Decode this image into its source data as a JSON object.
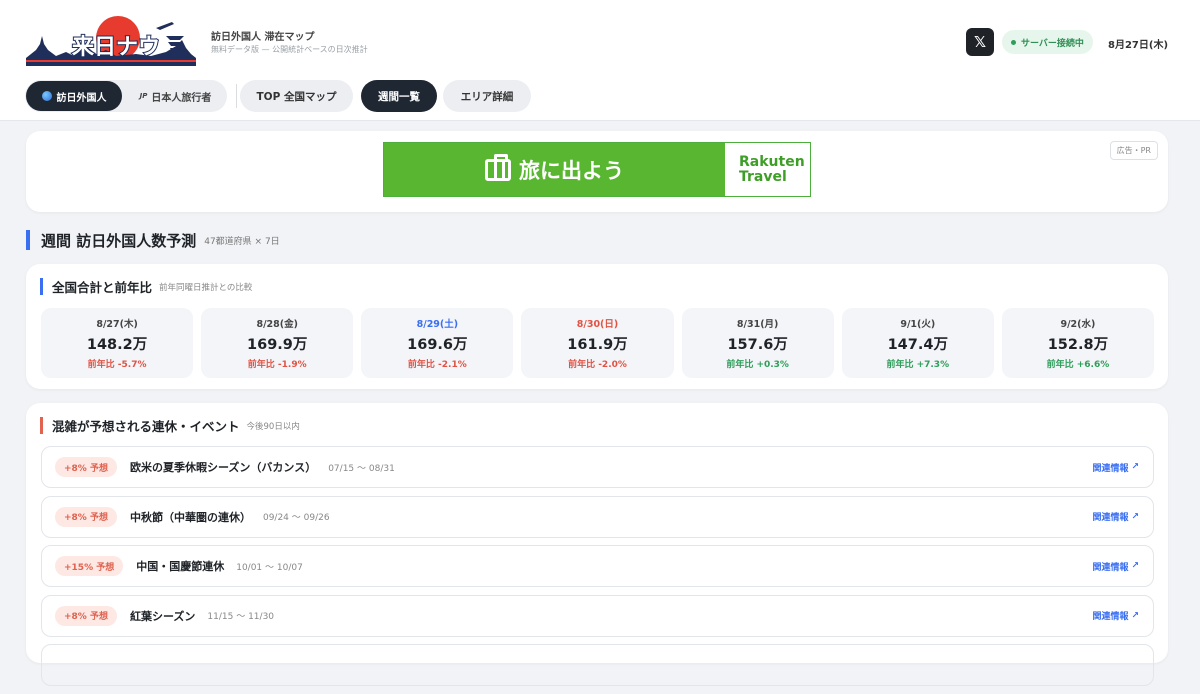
{
  "header": {
    "logo_text": "来日ナウ",
    "site_name": "訪日外国人 滞在マップ",
    "site_subtitle": "無料データ版 — 公開統計ベースの日次推計",
    "x_icon": "x-logo-icon",
    "status": "サーバー接続中",
    "status_color": "#2f9e5a",
    "date": "8月27日(木)"
  },
  "nav": {
    "segment": [
      {
        "label": "訪日外国人",
        "prefix": ""
      },
      {
        "label": "日本人旅行者",
        "prefix": "JP"
      }
    ],
    "pills": [
      {
        "label": "TOP 全国マップ"
      },
      {
        "label": "週間一覧"
      },
      {
        "label": "エリア詳細"
      }
    ],
    "active_pill": "週間一覧"
  },
  "ad": {
    "banner_text": "旅に出よう",
    "brand_line1": "Rakuten",
    "brand_line2": "Travel",
    "tag": "広告・PR",
    "brand_color": "#59b631"
  },
  "weekly": {
    "title": "週間 訪日外国人数予測",
    "subtitle": "47都道府県 × 7日"
  },
  "totals": {
    "title": "全国合計と前年比",
    "subtitle": "前年同曜日推計との比較",
    "days": [
      {
        "label": "8/27(木)",
        "value": "148.2万",
        "yoy": "前年比 -5.7%",
        "kind": "",
        "trend": "neg"
      },
      {
        "label": "8/28(金)",
        "value": "169.9万",
        "yoy": "前年比 -1.9%",
        "kind": "",
        "trend": "neg"
      },
      {
        "label": "8/29(土)",
        "value": "169.6万",
        "yoy": "前年比 -2.1%",
        "kind": "sat",
        "trend": "neg"
      },
      {
        "label": "8/30(日)",
        "value": "161.9万",
        "yoy": "前年比 -2.0%",
        "kind": "sun",
        "trend": "neg"
      },
      {
        "label": "8/31(月)",
        "value": "157.6万",
        "yoy": "前年比 +0.3%",
        "kind": "",
        "trend": "pos"
      },
      {
        "label": "9/1(火)",
        "value": "147.4万",
        "yoy": "前年比 +7.3%",
        "kind": "",
        "trend": "pos"
      },
      {
        "label": "9/2(水)",
        "value": "152.8万",
        "yoy": "前年比 +6.6%",
        "kind": "",
        "trend": "pos"
      }
    ]
  },
  "events": {
    "title": "混雑が予想される連休・イベント",
    "subtitle": "今後90日以内",
    "link_label": "関連情報",
    "items": [
      {
        "badge": "+8% 予想",
        "name": "欧米の夏季休暇シーズン（バカンス）",
        "range": "07/15 〜 08/31"
      },
      {
        "badge": "+8% 予想",
        "name": "中秋節（中華圏の連休）",
        "range": "09/24 〜 09/26"
      },
      {
        "badge": "+15% 予想",
        "name": "中国・国慶節連休",
        "range": "10/01 〜 10/07"
      },
      {
        "badge": "+8% 予想",
        "name": "紅葉シーズン",
        "range": "11/15 〜 11/30"
      }
    ]
  }
}
